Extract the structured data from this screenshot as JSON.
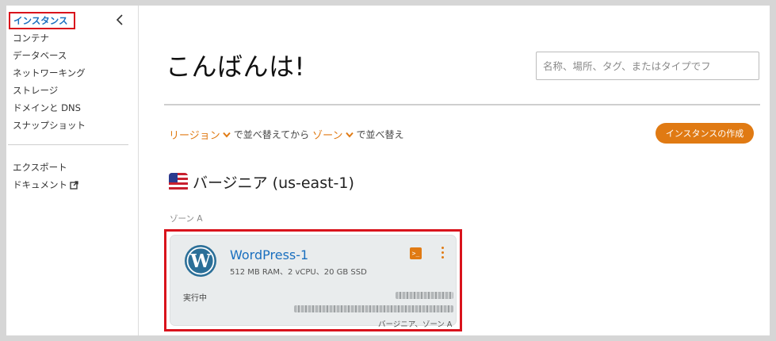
{
  "sidebar": {
    "collapse_icon": "chevron-left-icon",
    "items": [
      {
        "label": "インスタンス",
        "active": true
      },
      {
        "label": "コンテナ"
      },
      {
        "label": "データベース"
      },
      {
        "label": "ネットワーキング"
      },
      {
        "label": "ストレージ"
      },
      {
        "label": "ドメインと DNS"
      },
      {
        "label": "スナップショット"
      }
    ],
    "secondary": [
      {
        "label": "エクスポート"
      },
      {
        "label": "ドキュメント",
        "icon": "external-link-icon"
      }
    ]
  },
  "main": {
    "greeting": "こんばんは!",
    "search": {
      "placeholder": "名称、場所、タグ、またはタイプでフ",
      "value": ""
    },
    "sort": {
      "region_dropdown": "リージョン",
      "middle_text": "で並べ替えてから",
      "zone_dropdown": "ゾーン",
      "end_text": "で並べ替え"
    },
    "create_button": "インスタンスの作成",
    "region": {
      "name": "バージニア (us-east-1)",
      "flag": "us-flag-icon"
    },
    "zone_label": "ゾーン A",
    "instance": {
      "name": "WordPress-1",
      "specs": "512 MB RAM、2 vCPU、20 GB SSD",
      "status": "実行中",
      "location": "バージニア、ゾーン A",
      "icon": "wordpress-logo-icon"
    }
  },
  "colors": {
    "accent_orange": "#e07a13",
    "link_blue": "#1a6fbf",
    "highlight_red": "#d9131c"
  }
}
